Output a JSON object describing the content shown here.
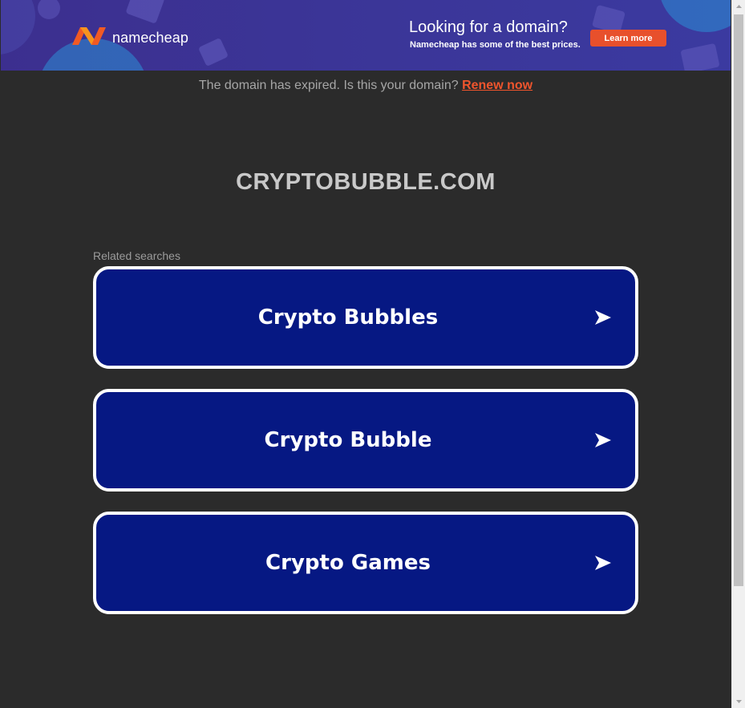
{
  "banner": {
    "brand": "namecheap",
    "headline": "Looking for a domain?",
    "subline": "Namecheap has some of the best prices.",
    "cta_label": "Learn more",
    "logo_icon": "namecheap-n-logo-icon",
    "colors": {
      "background": "#3b3597",
      "cta": "#e8502c",
      "logo_orange": "#f15a24"
    }
  },
  "notice": {
    "text": "The domain has expired. Is this your domain?",
    "link_label": "Renew now"
  },
  "domain_title": "CRYPTOBUBBLE.COM",
  "related": {
    "label": "Related searches",
    "items": [
      {
        "label": "Crypto Bubbles",
        "icon": "arrow-right-icon"
      },
      {
        "label": "Crypto Bubble",
        "icon": "arrow-right-icon"
      },
      {
        "label": "Crypto Games",
        "icon": "arrow-right-icon"
      }
    ]
  },
  "colors": {
    "page_background": "#2b2b2b",
    "search_tile": "#061883",
    "search_tile_border": "#ffffff",
    "renew_link": "#f0552d"
  }
}
